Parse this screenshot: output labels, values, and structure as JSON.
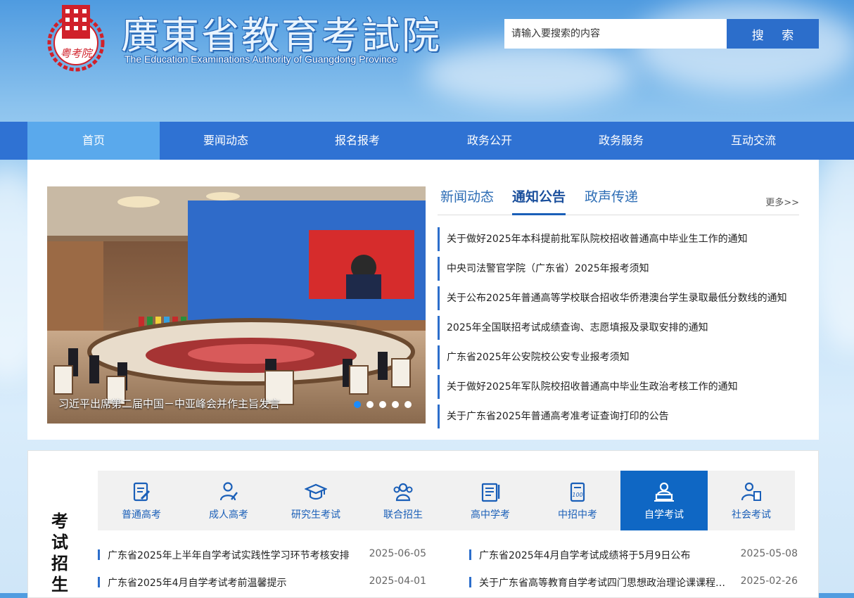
{
  "header": {
    "logo_cn": "廣東省教育考試院",
    "logo_en": "The Education Examinations Authority of Guangdong Province",
    "seal_text": "粤考院",
    "search_placeholder": "请输入要搜索的内容",
    "search_label": "搜 索"
  },
  "nav": [
    "首页",
    "要闻动态",
    "报名报考",
    "政务公开",
    "政务服务",
    "互动交流"
  ],
  "carousel": {
    "caption": "习近平出席第二届中国－中亚峰会并作主旨发言",
    "slide_count": 5,
    "active_slide": 1
  },
  "tabs": {
    "items": [
      "新闻动态",
      "通知公告",
      "政声传递"
    ],
    "active": "通知公告",
    "more": "更多>>"
  },
  "news": [
    "关于做好2025年本科提前批军队院校招收普通高中毕业生工作的通知",
    "中央司法警官学院（广东省）2025年报考须知",
    "关于公布2025年普通高等学校联合招收华侨港澳台学生录取最低分数线的通知",
    "2025年全国联招考试成绩查询、志愿填报及录取安排的通知",
    "广东省2025年公安院校公安专业报考须知",
    "关于做好2025年军队院校招收普通高中毕业生政治考核工作的通知",
    "关于广东省2025年普通高考准考证查询打印的公告"
  ],
  "exam_section": {
    "title": "考试招生",
    "categories": [
      {
        "label": "普通高考",
        "icon": "document-pen-icon"
      },
      {
        "label": "成人高考",
        "icon": "person-pen-icon"
      },
      {
        "label": "研究生考试",
        "icon": "graduation-cap-icon"
      },
      {
        "label": "联合招生",
        "icon": "group-icon"
      },
      {
        "label": "高中学考",
        "icon": "clipboard-icon"
      },
      {
        "label": "中招中考",
        "icon": "score-sheet-icon"
      },
      {
        "label": "自学考试",
        "icon": "laptop-user-icon"
      },
      {
        "label": "社会考试",
        "icon": "person-doc-icon"
      }
    ],
    "active_category": "自学考试",
    "items": [
      {
        "title": "广东省2025年上半年自学考试实践性学习环节考核安排",
        "date": "2025-06-05"
      },
      {
        "title": "广东省2025年4月自学考试成绩将于5月9日公布",
        "date": "2025-05-08"
      },
      {
        "title": "广东省2025年4月自学考试考前温馨提示",
        "date": "2025-04-01"
      },
      {
        "title": "关于广东省高等教育自学考试四门思想政治理论课课程调整的通知",
        "date": "2025-02-26"
      }
    ]
  },
  "colors": {
    "nav_bg": "#2f72d3",
    "nav_active": "#5aa9ec",
    "accent": "#2c6ecb",
    "seal_red": "#d0202a"
  }
}
